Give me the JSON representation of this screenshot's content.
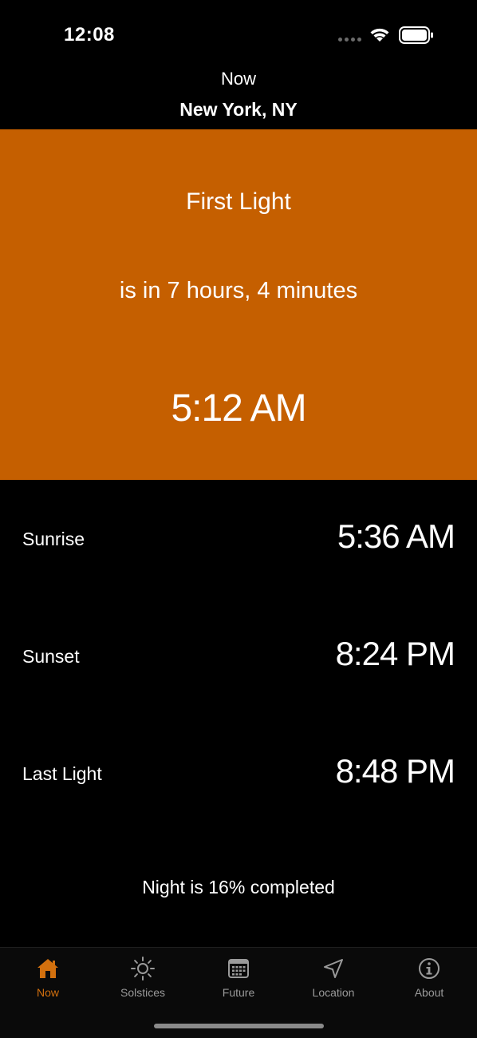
{
  "status_bar": {
    "time": "12:08"
  },
  "header": {
    "subtitle": "Now",
    "title": "New York, NY"
  },
  "hero": {
    "event": "First Light",
    "countdown": "is in 7 hours, 4 minutes",
    "time": "5:12 AM",
    "color": "#c55f00"
  },
  "rows": [
    {
      "label": "Sunrise",
      "value": "5:36 AM"
    },
    {
      "label": "Sunset",
      "value": "8:24 PM"
    },
    {
      "label": "Last Light",
      "value": "8:48 PM"
    }
  ],
  "progress": {
    "text": "Night is 16% completed",
    "percent": 16
  },
  "tabs": [
    {
      "label": "Now",
      "icon": "house-icon",
      "active": true
    },
    {
      "label": "Solstices",
      "icon": "sun-icon",
      "active": false
    },
    {
      "label": "Future",
      "icon": "calendar-icon",
      "active": false
    },
    {
      "label": "Location",
      "icon": "location-arrow-icon",
      "active": false
    },
    {
      "label": "About",
      "icon": "info-icon",
      "active": false
    }
  ],
  "colors": {
    "accent": "#d2700e",
    "inactive_tab": "#9a9a9a"
  }
}
